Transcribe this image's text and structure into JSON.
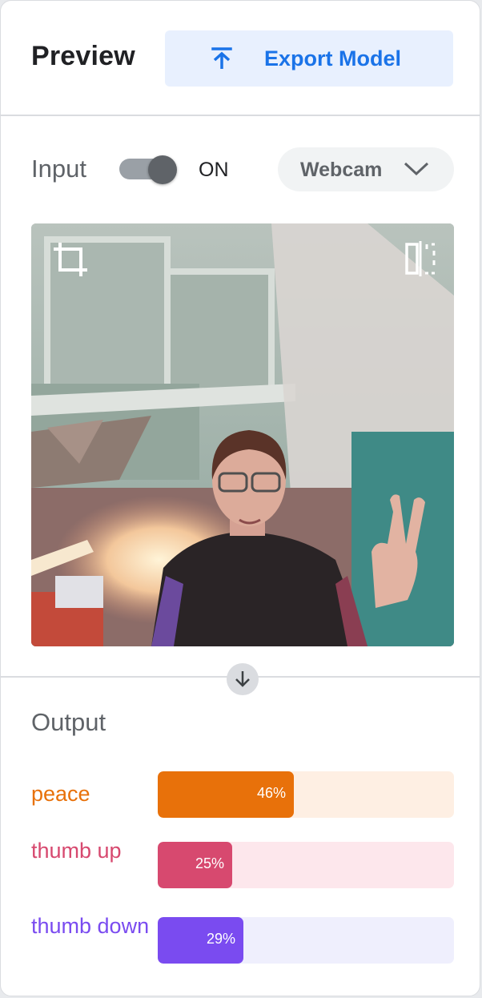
{
  "header": {
    "title": "Preview",
    "export_label": "Export Model",
    "export_icon": "upload-icon"
  },
  "input": {
    "label": "Input",
    "toggle_state": "ON",
    "toggle_on": true,
    "source_select": "Webcam"
  },
  "preview": {
    "crop_icon": "crop-icon",
    "flip_icon": "flip-horizontal-icon"
  },
  "output": {
    "label": "Output",
    "classes": [
      {
        "name": "peace",
        "percent": 46,
        "percent_label": "46%",
        "color": "#e8710a",
        "track_color": "#feefe3"
      },
      {
        "name": "thumb up",
        "percent": 25,
        "percent_label": "25%",
        "color": "#d7496f",
        "track_color": "#fde7ec"
      },
      {
        "name": "thumb down",
        "percent": 29,
        "percent_label": "29%",
        "color": "#7a4bf0",
        "track_color": "#efeffd"
      }
    ]
  },
  "colors": {
    "accent": "#1a73e8",
    "accent_bg": "#e8f0fe"
  }
}
